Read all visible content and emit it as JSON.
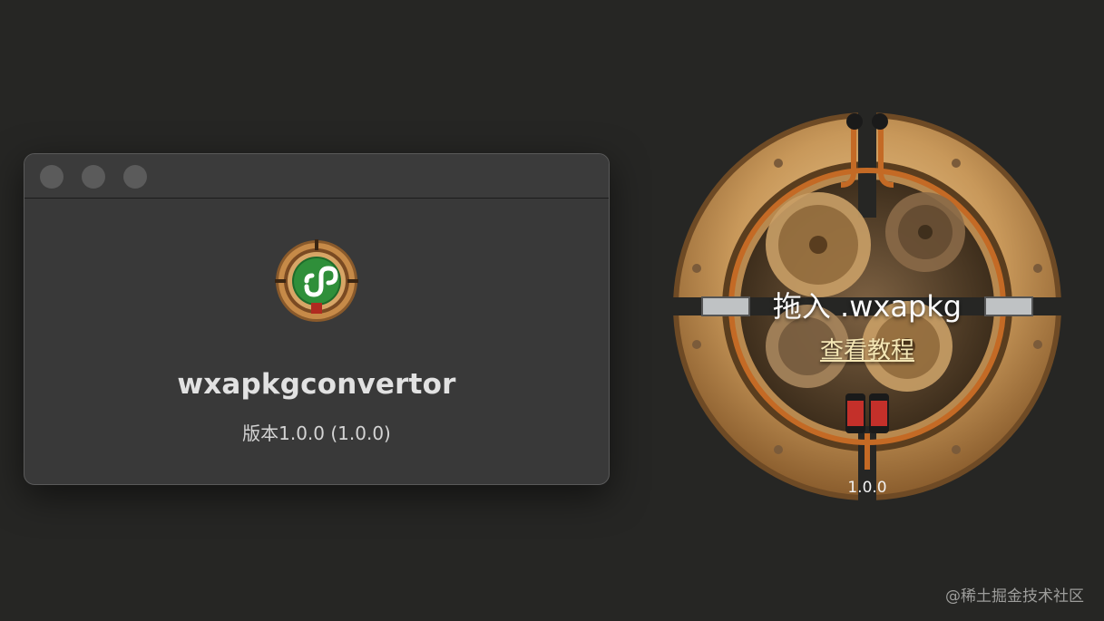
{
  "about_window": {
    "app_name": "wxapkgconvertor",
    "version_label": "版本1.0.0 (1.0.0)"
  },
  "drop_dial": {
    "drop_text": "拖入 .wxapkg",
    "tutorial_link": "查看教程",
    "version": "1.0.0"
  },
  "watermark": "@稀土掘金技术社区",
  "colors": {
    "background": "#262624",
    "window": "#393939",
    "brass": "#c59a5c",
    "app_icon_green": "#2f8f3a"
  }
}
